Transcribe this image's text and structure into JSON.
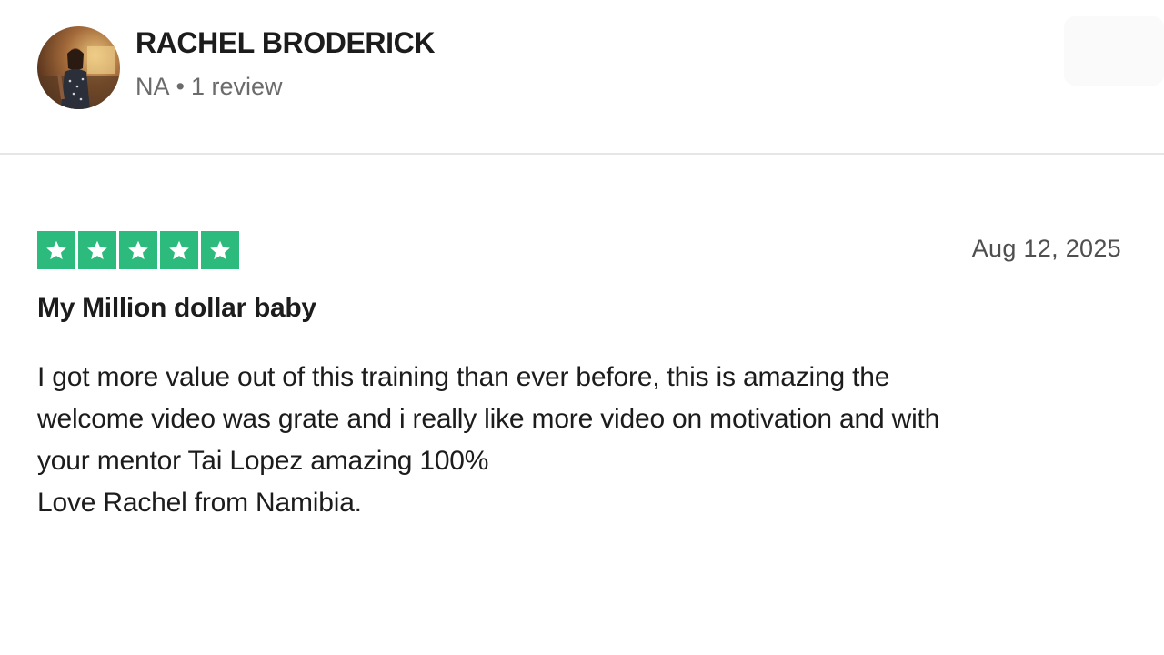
{
  "reviewer": {
    "name": "RACHEL BRODERICK",
    "country": "NA",
    "separator": "•",
    "review_count": "1 review",
    "avatar_icon": "user-photo-avatar"
  },
  "review": {
    "rating": 5,
    "max_rating": 5,
    "star_color": "#2dba7d",
    "date": "Aug 12, 2025",
    "title": "My Million dollar baby",
    "body_lines": [
      "I got more value out of this training than ever before, this is amazing the",
      "welcome video was grate and i really like more video on motivation and with",
      "your mentor Tai Lopez amazing 100%",
      "Love Rachel from Namibia."
    ]
  }
}
